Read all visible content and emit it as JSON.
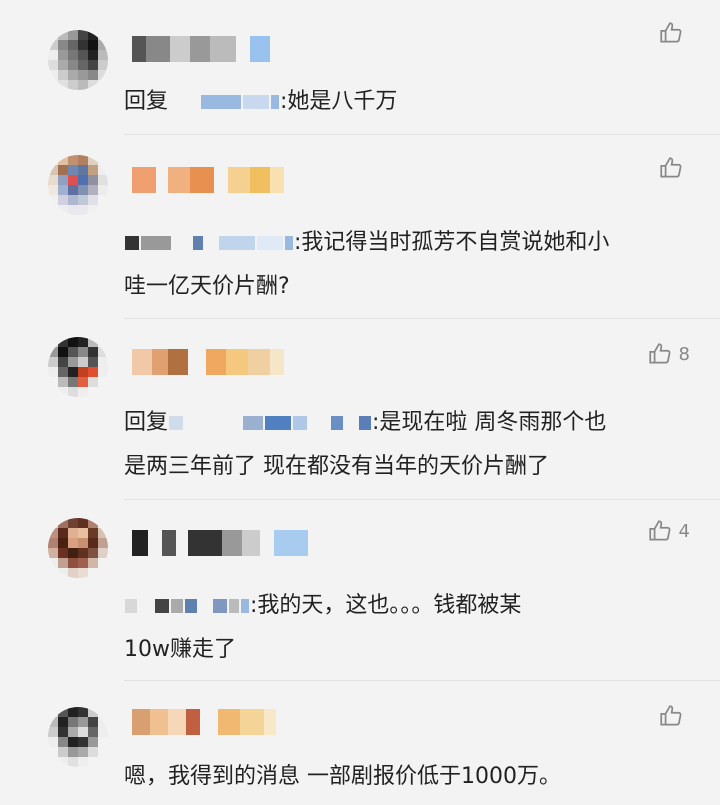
{
  "colors": {
    "background": "#f3f3f3",
    "text": "#222222",
    "muted": "#888888",
    "divider": "#e2e2e2"
  },
  "comments": [
    {
      "like_icon": "thumbs-up-icon",
      "likes": "",
      "reply_prefix": "回复",
      "text": ":她是八千万",
      "line2": ""
    },
    {
      "like_icon": "thumbs-up-icon",
      "likes": "",
      "reply_prefix": "",
      "text": ":我记得当时孤芳不自赏说她和小",
      "line2": "哇一亿天价片酬?"
    },
    {
      "like_icon": "thumbs-up-icon",
      "likes": "8",
      "reply_prefix": "回复",
      "text": ":是现在啦 周冬雨那个也",
      "line2": "是两三年前了 现在都没有当年的天价片酬了"
    },
    {
      "like_icon": "thumbs-up-icon",
      "likes": "4",
      "reply_prefix": "",
      "text": ":我的天，这也。。。钱都被某",
      "line2": "10w赚走了"
    },
    {
      "like_icon": "thumbs-up-icon",
      "likes": "",
      "reply_prefix": "",
      "text": "嗯，我得到的消息 一部剧报价低于1000万。",
      "line2": ""
    }
  ]
}
